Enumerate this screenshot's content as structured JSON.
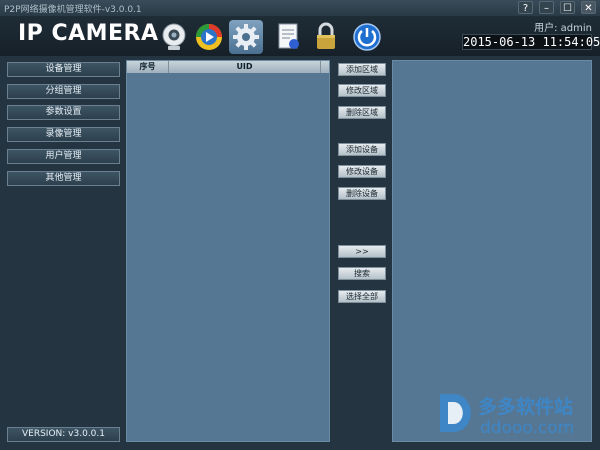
{
  "window": {
    "title": "P2P网络摄像机管理软件-v3.0.0.1",
    "buttons": {
      "help": "?",
      "minimize": "–",
      "maximize": "☐",
      "close": "✕"
    }
  },
  "header": {
    "logo": "IP CAMERA",
    "user": "用户: admin",
    "datetime": "2015-06-13  11:54:05",
    "tools": [
      "webcam-icon",
      "play-icon",
      "settings-gear-icon",
      "document-icon",
      "lock-icon",
      "power-icon"
    ]
  },
  "sidebar": {
    "items": [
      {
        "label": "设备管理"
      },
      {
        "label": "分组管理"
      },
      {
        "label": "参数设置"
      },
      {
        "label": "录像管理"
      },
      {
        "label": "用户管理"
      },
      {
        "label": "其他管理"
      }
    ],
    "version": "VERSION: v3.0.0.1"
  },
  "device_list": {
    "columns": [
      "序号",
      "UID"
    ]
  },
  "actions": {
    "add_area": "添加区域",
    "edit_area": "修改区域",
    "delete_area": "删除区域",
    "add_device": "添加设备",
    "edit_device": "修改设备",
    "delete_device": "删除设备",
    "move": ">>",
    "search": "搜索",
    "select_all": "选择全部"
  },
  "watermark": {
    "brand": "多多软件站",
    "url": "ddooo.com"
  },
  "colors": {
    "background": "#243440",
    "panel": "#557794",
    "accent": "#3f86c6"
  }
}
